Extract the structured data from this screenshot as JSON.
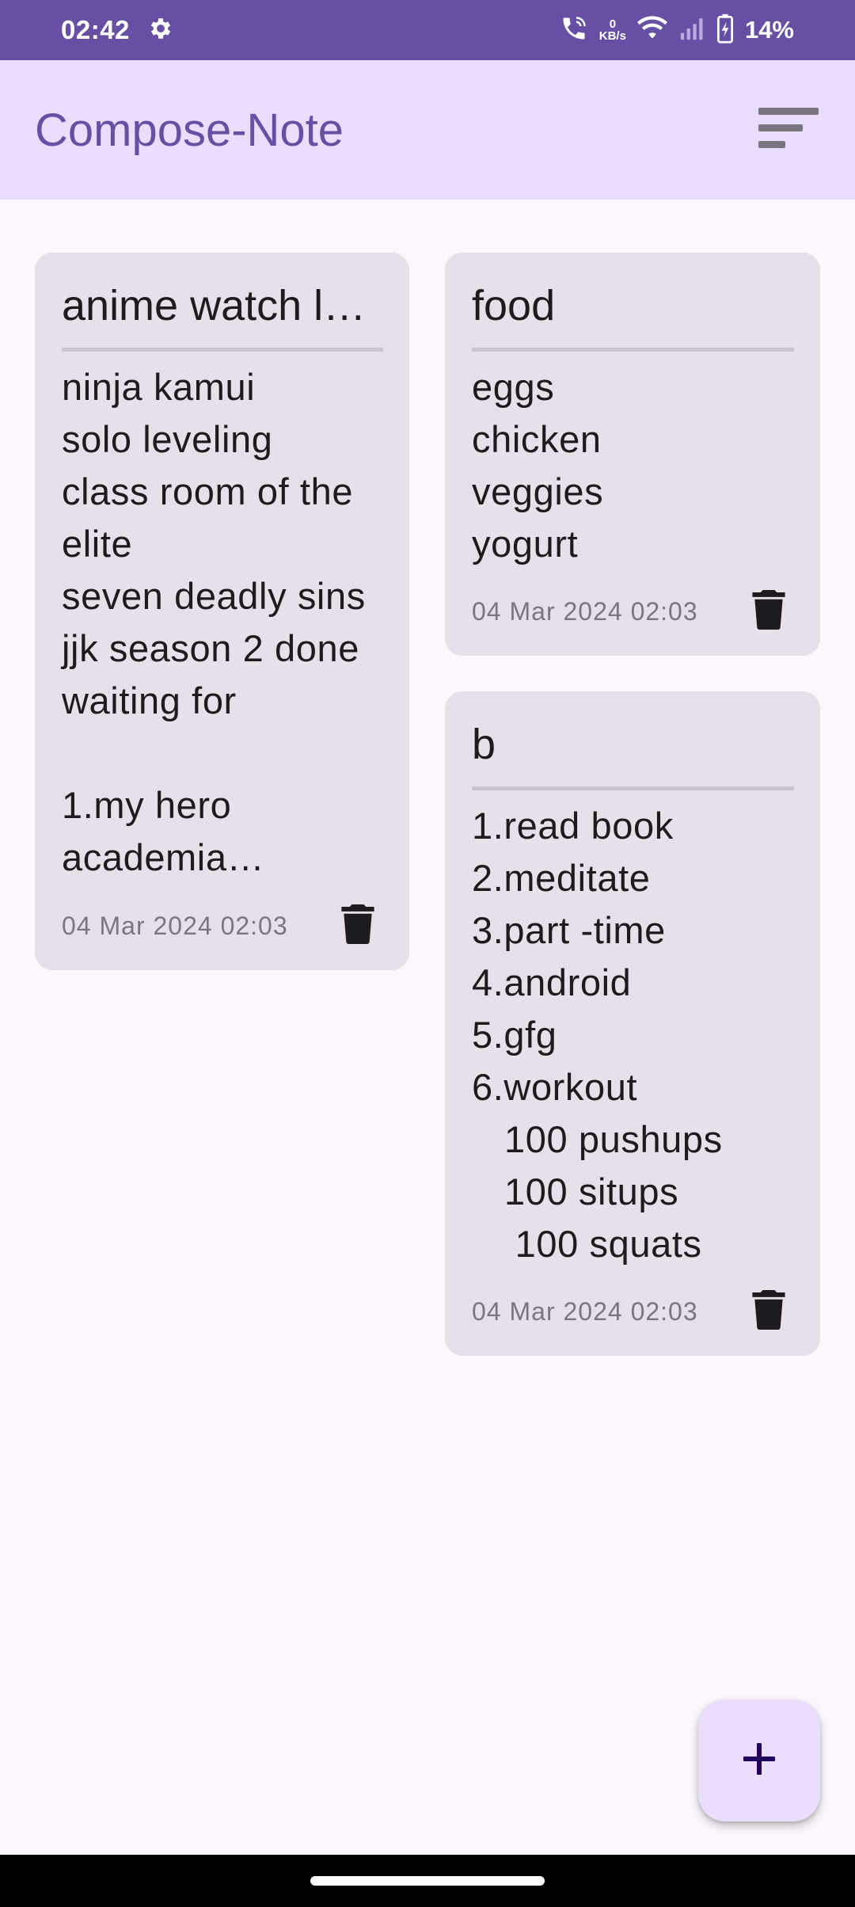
{
  "status_bar": {
    "time": "02:42",
    "data_rate_value": "0",
    "data_rate_unit": "KB/s",
    "battery_percent": "14%",
    "icons": [
      "settings-gear-icon",
      "wifi-call-icon",
      "wifi-icon",
      "signal-icon",
      "battery-charging-icon"
    ]
  },
  "app_bar": {
    "title": "Compose-Note",
    "sort_icon": "sort-icon"
  },
  "notes": [
    {
      "title": "anime watch l…",
      "body": "ninja kamui\nsolo leveling\nclass room of the\nelite\nseven deadly sins\njjk season 2 done\nwaiting for\n\n1.my hero\nacademia…",
      "date": "04 Mar 2024 02:03"
    },
    {
      "title": "food",
      "body": "eggs\nchicken\nveggies\nyogurt",
      "date": "04 Mar 2024 02:03"
    },
    {
      "title": "b",
      "body": "1.read book\n2.meditate\n3.part -time\n4.android\n5.gfg\n6.workout\n   100 pushups\n   100 situps\n    100 squats",
      "date": "04 Mar 2024 02:03"
    }
  ],
  "fab": {
    "icon": "plus-icon"
  },
  "colors": {
    "primary": "#6750a4",
    "app_bar_bg": "#eaddff",
    "card_bg": "#e7e0eb",
    "background": "#fdf7fd"
  }
}
